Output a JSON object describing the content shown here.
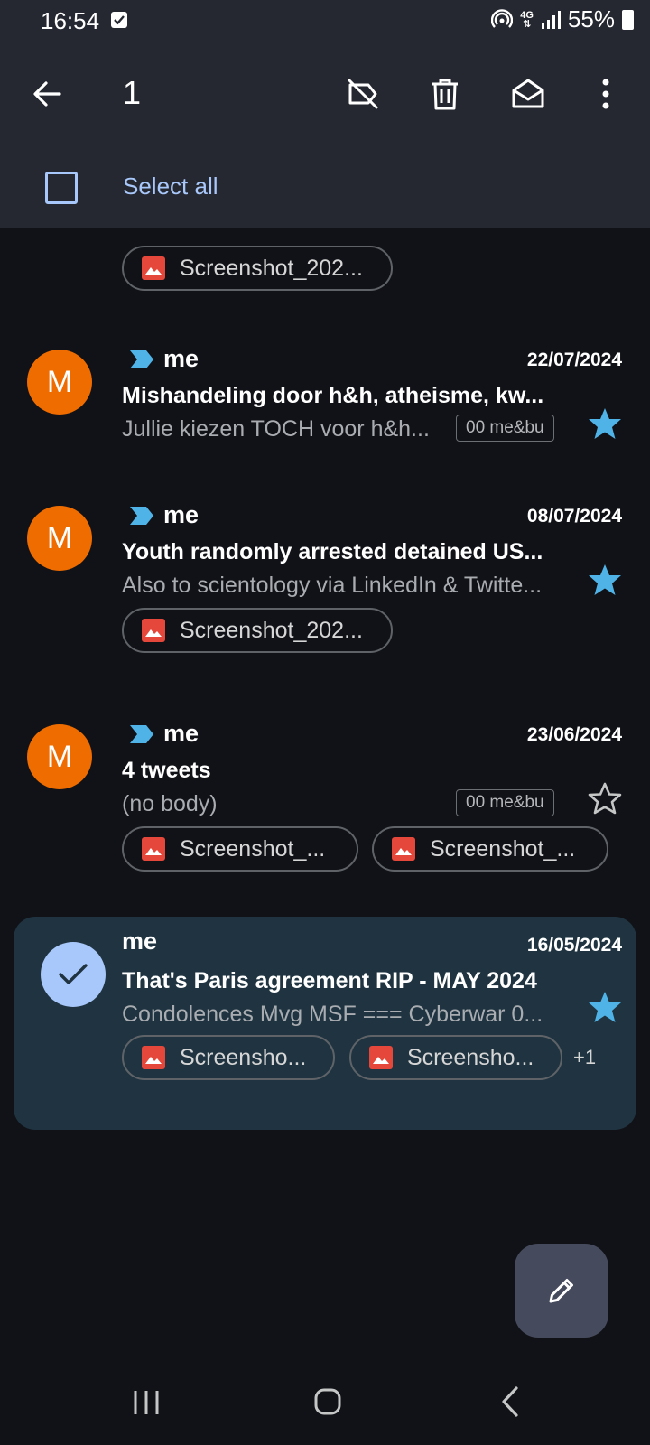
{
  "status_bar": {
    "time": "16:54",
    "network": "4G",
    "battery": "55%"
  },
  "toolbar": {
    "selected_count": "1"
  },
  "select_all": {
    "label": "Select all"
  },
  "emails": [
    {
      "attachments": [
        "Screenshot_202..."
      ]
    },
    {
      "avatar": "M",
      "sender": "me",
      "date": "22/07/2024",
      "subject": "Mishandeling door h&h, atheisme, kw...",
      "snippet": "Jullie kiezen TOCH voor h&h...",
      "label": "00 me&bu",
      "starred": true
    },
    {
      "avatar": "M",
      "sender": "me",
      "date": "08/07/2024",
      "subject": "Youth randomly arrested detained US...",
      "snippet": "Also to scientology via LinkedIn & Twitte...",
      "attachments": [
        "Screenshot_202..."
      ],
      "starred": true
    },
    {
      "avatar": "M",
      "sender": "me",
      "date": "23/06/2024",
      "subject": "4 tweets",
      "snippet": "(no body)",
      "label": "00 me&bu",
      "attachments": [
        "Screenshot_...",
        "Screenshot_..."
      ],
      "starred": false
    },
    {
      "selected": true,
      "sender": "me",
      "date": "16/05/2024",
      "subject": "That's Paris agreement RIP - MAY 2024",
      "snippet": "Condolences Mvg MSF === Cyberwar 0...",
      "attachments": [
        "Screensho...",
        "Screensho..."
      ],
      "more_attachments": "+1",
      "starred": true
    }
  ],
  "colors": {
    "accent": "#a8c7fa",
    "star": "#4fb3e8",
    "avatar": "#ef6c00",
    "important": "#4fb3e8"
  }
}
